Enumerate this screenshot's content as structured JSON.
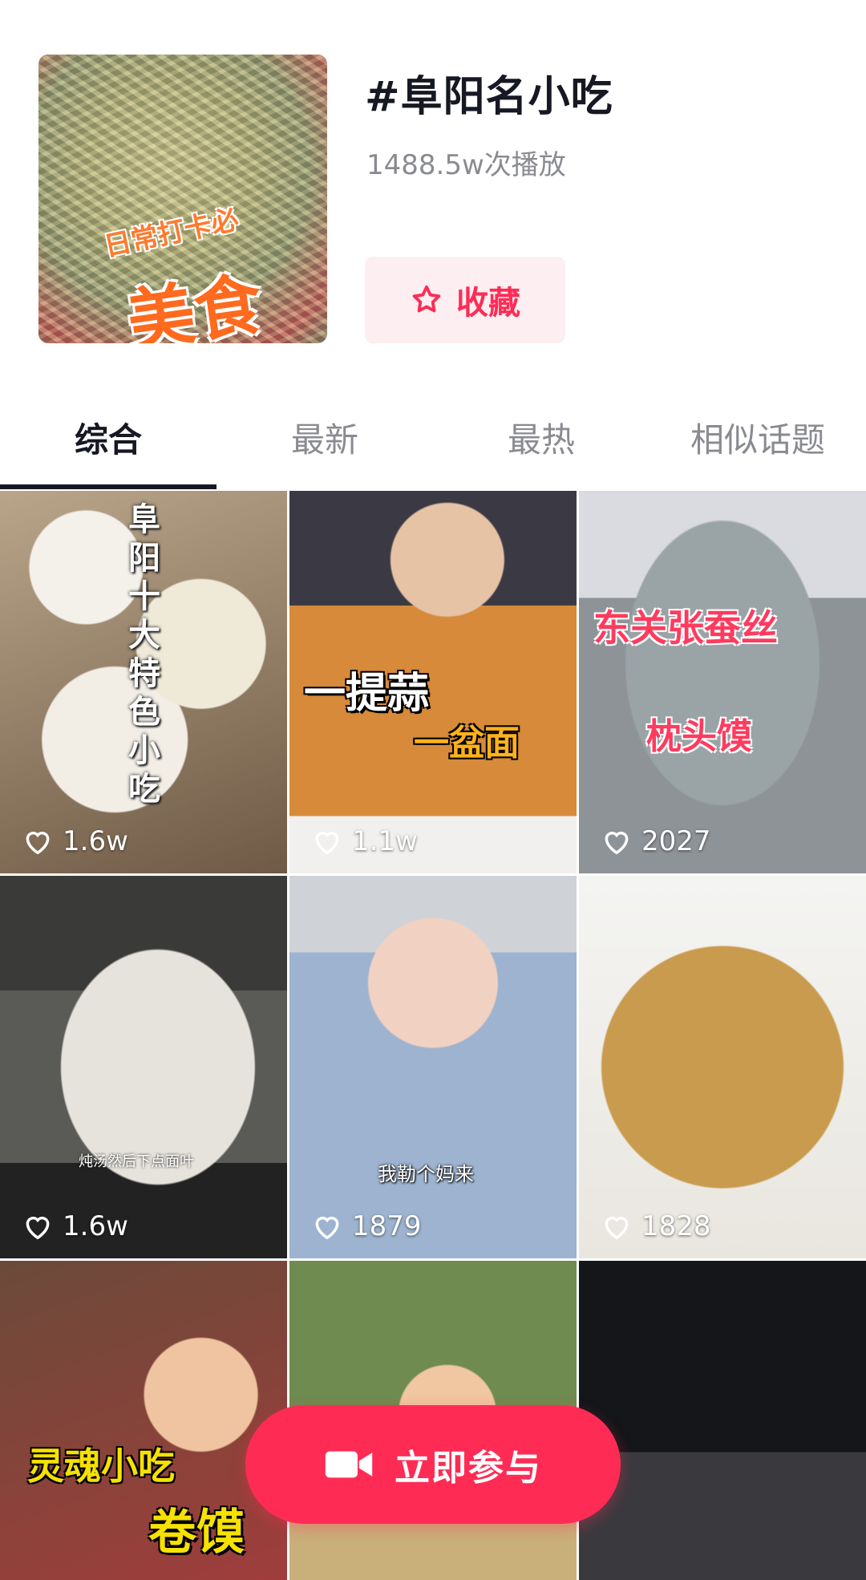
{
  "topic": {
    "title": "#阜阳名小吃",
    "plays": "1488.5w次播放",
    "cover": {
      "small_text": "日常打卡必",
      "big_text": "美食"
    },
    "favorite_label": "收藏"
  },
  "tabs": [
    {
      "label": "综合",
      "active": true
    },
    {
      "label": "最新",
      "active": false
    },
    {
      "label": "最热",
      "active": false
    },
    {
      "label": "相似话题",
      "active": false
    }
  ],
  "videos": [
    {
      "likes": "1.6w",
      "overlay_a": "阜阳十大特色小吃",
      "overlay_b": ""
    },
    {
      "likes": "1.1w",
      "overlay_a": "一提蒜",
      "overlay_b": "一盆面"
    },
    {
      "likes": "2027",
      "overlay_a": "东关张蚕丝",
      "overlay_b": "枕头馍"
    },
    {
      "likes": "1.6w",
      "overlay_a": "炖汤然后下点面叶",
      "overlay_b": ""
    },
    {
      "likes": "1879",
      "overlay_a": "我勒个妈来",
      "overlay_b": ""
    },
    {
      "likes": "1828",
      "overlay_a": "",
      "overlay_b": ""
    },
    {
      "likes": "",
      "overlay_a": "灵魂小吃",
      "overlay_b": "卷馍"
    },
    {
      "likes": "",
      "overlay_a": "",
      "overlay_b": ""
    },
    {
      "likes": "",
      "overlay_a": "",
      "overlay_b": ""
    }
  ],
  "join_button": {
    "label": "立即参与",
    "icon": "video-camera-icon"
  },
  "colors": {
    "accent": "#fe2c55",
    "accent_bg": "#fdeef1",
    "text": "#161823",
    "muted": "#8a8b91"
  }
}
